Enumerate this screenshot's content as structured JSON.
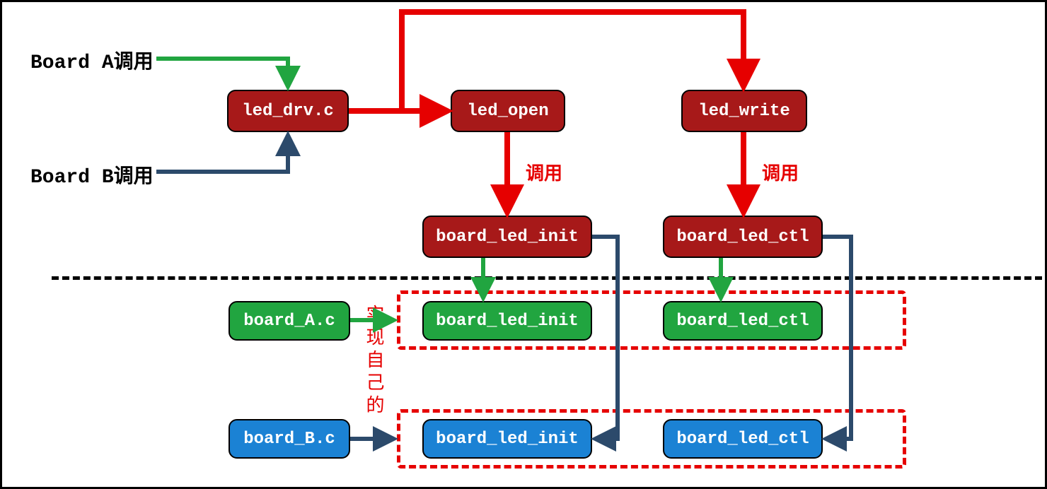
{
  "labels": {
    "board_a_call": "Board A调用",
    "board_b_call": "Board B调用",
    "call1": "调用",
    "call2": "调用",
    "implement_own": "实现自己的"
  },
  "nodes": {
    "led_drv": {
      "text": "led_drv.c",
      "color": "red"
    },
    "led_open": {
      "text": "led_open",
      "color": "red"
    },
    "led_write": {
      "text": "led_write",
      "color": "red"
    },
    "bli_top": {
      "text": "board_led_init",
      "color": "red"
    },
    "blc_top": {
      "text": "board_led_ctl",
      "color": "red"
    },
    "board_a": {
      "text": "board_A.c",
      "color": "green"
    },
    "board_b": {
      "text": "board_B.c",
      "color": "blue"
    },
    "bli_a": {
      "text": "board_led_init",
      "color": "green"
    },
    "blc_a": {
      "text": "board_led_ctl",
      "color": "green"
    },
    "bli_b": {
      "text": "board_led_init",
      "color": "blue"
    },
    "blc_b": {
      "text": "board_led_ctl",
      "color": "blue"
    }
  },
  "colors": {
    "red": "#e60000",
    "green": "#21a540",
    "navy": "#2c4a6b"
  }
}
